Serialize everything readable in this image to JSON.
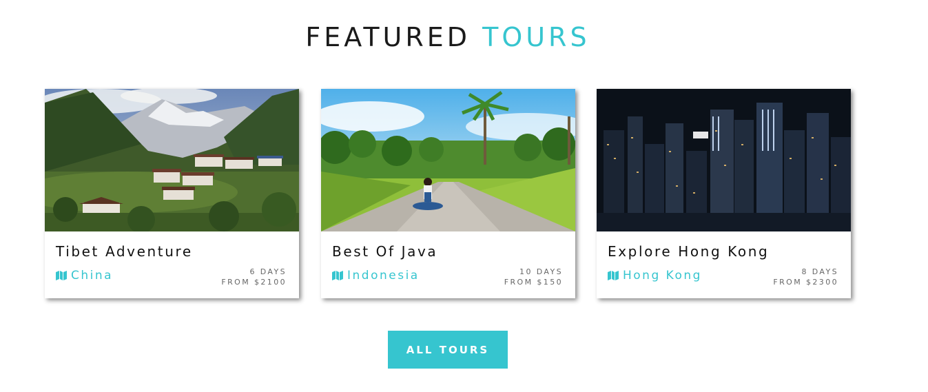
{
  "heading": {
    "part1": "FEATURED",
    "part2": "TOURS"
  },
  "colors": {
    "accent": "#36c5cf",
    "text": "#111111",
    "muted": "#666666"
  },
  "tours": [
    {
      "title": "Tibet Adventure",
      "location": "China",
      "duration": "6 DAYS",
      "price": "FROM $2100",
      "location_icon": "map-icon"
    },
    {
      "title": "Best Of Java",
      "location": "Indonesia",
      "duration": "10 DAYS",
      "price": "FROM $150",
      "location_icon": "map-icon"
    },
    {
      "title": "Explore Hong Kong",
      "location": "Hong Kong",
      "duration": "8 DAYS",
      "price": "FROM $2300",
      "location_icon": "map-icon"
    }
  ],
  "cta": {
    "label": "ALL TOURS"
  }
}
